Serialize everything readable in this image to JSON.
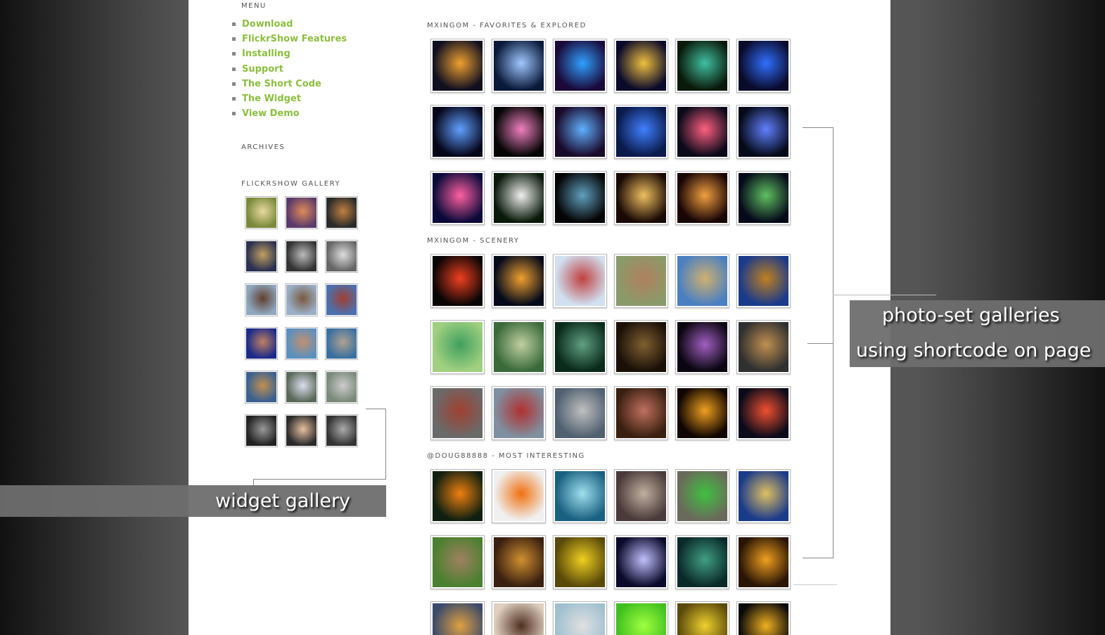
{
  "sidebar": {
    "menu_heading": "MENU",
    "menu_items": [
      {
        "label": "Download"
      },
      {
        "label": "FlickrShow Features"
      },
      {
        "label": "Installing"
      },
      {
        "label": "Support"
      },
      {
        "label": "The Short Code"
      },
      {
        "label": "The Widget"
      },
      {
        "label": "View Demo"
      }
    ],
    "archives_heading": "ARCHIVES",
    "gallery_heading": "FLICKRSHOW GALLERY",
    "gallery_thumbs": [
      [
        "#7a8a3a",
        "#e8d9a0"
      ],
      [
        "#5a3a6a",
        "#e08a5a"
      ],
      [
        "#2a2a2a",
        "#c08040"
      ],
      [
        "#2a3050",
        "#c0a060"
      ],
      [
        "#333",
        "#bbb"
      ],
      [
        "#666",
        "#ddd"
      ],
      [
        "#8fa8c0",
        "#604030"
      ],
      [
        "#9ab0c8",
        "#7a5a40"
      ],
      [
        "#4a70b0",
        "#a04030"
      ],
      [
        "#1a2a8a",
        "#c08060"
      ],
      [
        "#5a90c0",
        "#c09070"
      ],
      [
        "#3a70a0",
        "#b0a090"
      ],
      [
        "#3a6090",
        "#c09050"
      ],
      [
        "#5a6a5a",
        "#dde"
      ],
      [
        "#7a8a7a",
        "#ccc"
      ],
      [
        "#222",
        "#999"
      ],
      [
        "#2a2a2a",
        "#e8c0a0"
      ],
      [
        "#333",
        "#aaa"
      ]
    ]
  },
  "sections": [
    {
      "title": "MXINGꙨM - FAVORITES & EXPLORED",
      "thumbs": [
        [
          "#101020",
          "#f0a030"
        ],
        [
          "#0a1a3a",
          "#a0c8ff"
        ],
        [
          "#1a0a3a",
          "#30a0ff"
        ],
        [
          "#0a0a2a",
          "#f0c040"
        ],
        [
          "#0a1a0a",
          "#40c0a0"
        ],
        [
          "#0a0a2a",
          "#3070ff"
        ],
        [
          "#05051a",
          "#60a0ff"
        ],
        [
          "#050505",
          "#f080c0"
        ],
        [
          "#1a0a2a",
          "#60b0ff"
        ],
        [
          "#0a1a4a",
          "#4080ff"
        ],
        [
          "#0a0a1a",
          "#ff6080"
        ],
        [
          "#050a1a",
          "#6080ff"
        ],
        [
          "#0a0a3a",
          "#ff60a0"
        ],
        [
          "#0a1a0a",
          "#f0f0f0"
        ],
        [
          "#050505",
          "#60a0c0"
        ],
        [
          "#1a0a05",
          "#f0c060"
        ],
        [
          "#1a0505",
          "#f0a040"
        ],
        [
          "#050a1a",
          "#60c060"
        ]
      ]
    },
    {
      "title": "MXINGꙨM - SCENERY",
      "thumbs": [
        [
          "#0a0505",
          "#f04020"
        ],
        [
          "#050a1a",
          "#f0a030"
        ],
        [
          "#d0e0f0",
          "#c04040"
        ],
        [
          "#8a9a6a",
          "#b08060"
        ],
        [
          "#4a80c0",
          "#d0b070"
        ],
        [
          "#1a3a8a",
          "#c08020"
        ],
        [
          "#a0d080",
          "#40a060"
        ],
        [
          "#3a6a3a",
          "#c0d0a0"
        ],
        [
          "#0a2a1a",
          "#60a080"
        ],
        [
          "#1a1008",
          "#806030"
        ],
        [
          "#0a0510",
          "#a060c0"
        ],
        [
          "#303030",
          "#c09050"
        ],
        [
          "#6a6a6a",
          "#a04030"
        ],
        [
          "#8090a0",
          "#b03030"
        ],
        [
          "#506070",
          "#c0c0c0"
        ],
        [
          "#3a2010",
          "#c07060"
        ],
        [
          "#100500",
          "#f0a020"
        ],
        [
          "#0a0a1a",
          "#f05030"
        ]
      ]
    },
    {
      "title": "@DOUG88888 - MOST INTERESTING",
      "thumbs": [
        [
          "#102010",
          "#f08010"
        ],
        [
          "#f0f0f0",
          "#f07010"
        ],
        [
          "#1a6080",
          "#a0e0f0"
        ],
        [
          "#4a3a3a",
          "#c0b0a0"
        ],
        [
          "#6a6a5a",
          "#40c040"
        ],
        [
          "#1a3a8a",
          "#e0c060"
        ],
        [
          "#4a8030",
          "#a08060"
        ],
        [
          "#3a2010",
          "#d09030"
        ],
        [
          "#5a4a0a",
          "#f0d020"
        ],
        [
          "#0a0a2a",
          "#c0c0ff"
        ],
        [
          "#0a2a2a",
          "#40a080"
        ],
        [
          "#2a1505",
          "#f0a020"
        ],
        [
          "#3a4a6a",
          "#e0a040"
        ],
        [
          "#e0d0c0",
          "#503020"
        ],
        [
          "#a0c0d0",
          "#e0e0e0"
        ],
        [
          "#40c020",
          "#a0ff40"
        ],
        [
          "#5a4a0a",
          "#f0d030"
        ],
        [
          "#0a0a0a",
          "#f0b020"
        ]
      ]
    }
  ],
  "callouts": {
    "widget": "widget gallery",
    "photo_line1": "photo-set galleries",
    "photo_line2": "using shortcode on page"
  }
}
